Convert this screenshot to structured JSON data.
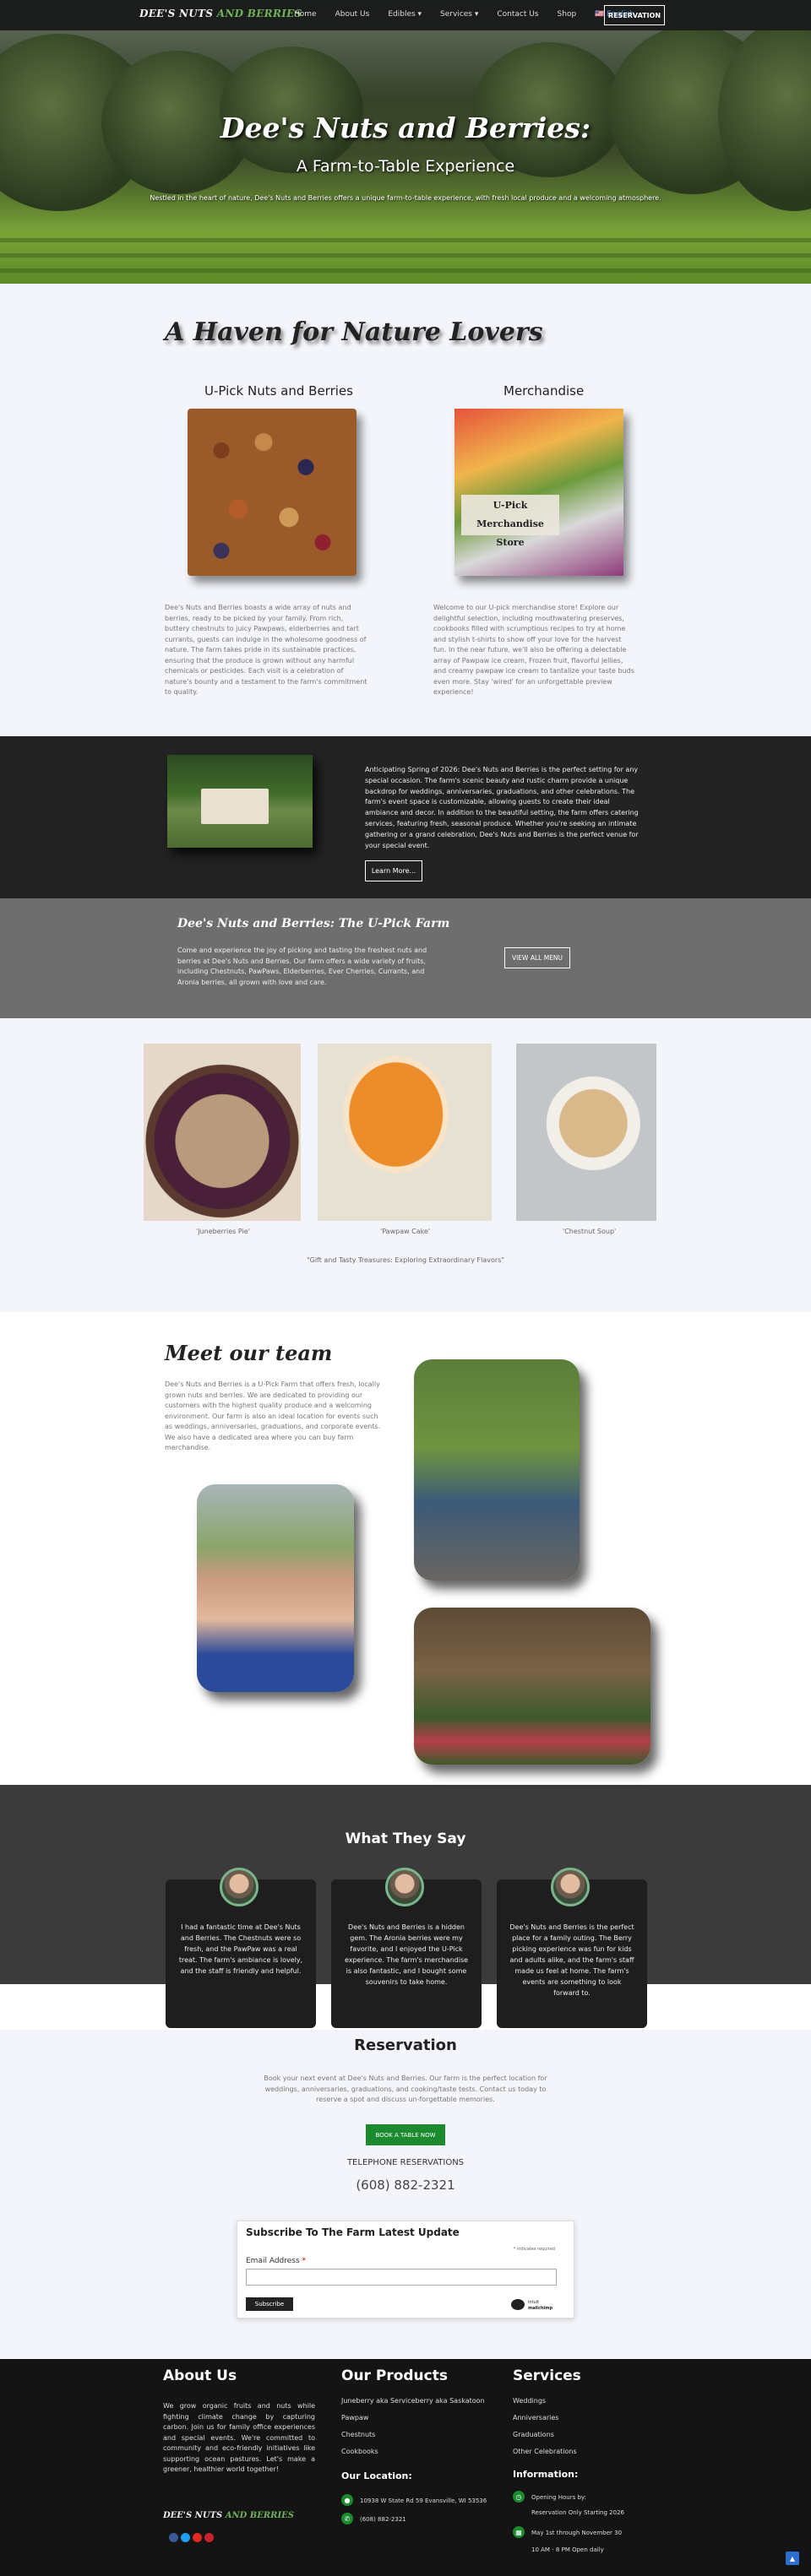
{
  "nav": {
    "logo_a": "DEE'S NUTS",
    "logo_b": " AND BERRIES",
    "links": [
      "Home",
      "About Us",
      "Edibles ▾",
      "Services ▾",
      "Contact Us",
      "Shop",
      "🇺🇸 English"
    ],
    "reservation": "RESERVATION"
  },
  "hero": {
    "title": "Dee's Nuts and Berries:",
    "subtitle": "A Farm-to-Table Experience",
    "text": "Nestled in the heart of nature, Dee's Nuts and Berries offers a unique farm-to-table experience, with fresh local produce and a welcoming atmosphere."
  },
  "haven": {
    "title": "A Haven for Nature Lovers",
    "left_heading": "U-Pick Nuts and Berries",
    "right_heading": "Merchandise",
    "merch_label_1": "U-Pick Merchandise",
    "merch_label_2": "Store",
    "left_text": "Dee's Nuts and Berries boasts a wide array of nuts and berries, ready to be picked by your family. From rich, buttery chestnuts to juicy Pawpaws, elderberries and tart currants, guests can indulge in the wholesome goodness of nature. The farm takes pride in its sustainable practices, ensuring that the produce is grown without any harmful chemicals or pesticides. Each visit is a celebration of nature's bounty and a testament to the farm's commitment to quality.",
    "right_text": "Welcome to our U-pick merchandise store! Explore our delightful selection, including mouthwatering preserves, cookbooks filled with scrumptious recipes to try at home and stylish t-shirts to show off your love for the harvest fun. In the near future, we'll also be offering a delectable array of Pawpaw ice cream, Frozen fruit, flavorful jellies, and creamy pawpaw ice cream to tantalize your taste buds even more. Stay 'wired' for an unforgettable preview experience!"
  },
  "events": {
    "text": "Anticipating Spring of 2026: Dee's Nuts and Berries is the perfect setting for any special occasion. The farm's scenic beauty and rustic charm provide a unique backdrop for weddings, anniversaries, graduations, and other celebrations. The farm's event space is customizable, allowing guests to create their ideal ambiance and decor. In addition to the beautiful setting, the farm offers catering services, featuring fresh, seasonal produce. Whether you're seeking an intimate gathering or a grand celebration, Dee's Nuts and Berries is the perfect venue for your special event.",
    "button": "Learn More..."
  },
  "upick": {
    "title": "Dee's Nuts and Berries: The U-Pick Farm",
    "text": "Come and experience the joy of picking and tasting the freshest nuts and berries at Dee's Nuts and Berries. Our farm offers a wide variety of fruits, including Chestnuts, PawPaws, Elderberries, Ever Cherries, Currants, and Aronia berries, all grown with love and care.",
    "button": "VIEW ALL MENU"
  },
  "foods": {
    "captions": [
      "'Juneberries Pie'",
      "'Pawpaw Cake'",
      "'Chestnut Soup'"
    ],
    "footer": "\"Gift and Tasty Treasures: Exploring Extraordinary Flavors\""
  },
  "team": {
    "title": "Meet our team",
    "text": "Dee's Nuts and Berries is a U-Pick Farm that offers fresh, locally grown nuts and berries. We are dedicated to providing our customers with the highest quality produce and a welcoming environment. Our farm is also an ideal location for events such as weddings, anniversaries, graduations, and corporate events. We also have a dedicated area where you can buy farm merchandise."
  },
  "testimonials": {
    "title": "What They Say",
    "items": [
      "I had a fantastic time at Dee's Nuts and Berries. The Chestnuts were so fresh, and the PawPaw was a real treat. The farm's ambiance is lovely, and the staff is friendly and helpful.",
      "Dee's Nuts and Berries is a hidden gem. The Aronia berries were my favorite, and I enjoyed the U-Pick experience. The farm's merchandise is also fantastic, and I bought some souvenirs to take home.",
      "Dee's Nuts and Berries is the perfect place for a family outing. The Berry picking experience was fun for kids and adults alike, and the farm's staff made us feel at home. The farm's events are something to look forward to."
    ]
  },
  "reservation": {
    "title": "Reservation",
    "text": "Book your next event at Dee's Nuts and Berries. Our farm is the perfect location for weddings, anniversaries, graduations, and cooking/taste tests. Contact us today to reserve a spot and discuss un-forgettable memories.",
    "button": "BOOK A TABLE NOW",
    "tel_label": "TELEPHONE RESERVATIONS",
    "phone": "(608) 882-2321"
  },
  "subscribe": {
    "title": "Subscribe To The Farm Latest Update",
    "indicates": "* indicates required",
    "email_label": "Email Address",
    "required": "*",
    "button": "Subscribe",
    "badge_1": "intuit",
    "badge_2": "mailchimp"
  },
  "footer": {
    "about_title": "About Us",
    "about_text": "We grow organic fruits and nuts while fighting climate change by capturing carbon. Join us for family office experiences and special events. We're committed to community and eco-friendly initiatives like supporting ocean pastures. Let's make a greener, healthier world together!",
    "logo_a": "DEE'S NUTS",
    "logo_b": " AND BERRIES",
    "products_title": "Our Products",
    "products": [
      "Juneberry aka Serviceberry aka Saskatoon",
      "Pawpaw",
      "Chestnuts",
      "Cookbooks"
    ],
    "services_title": "Services",
    "services": [
      "Weddings",
      "Anniversaries",
      "Graduations",
      "Other Celebrations"
    ],
    "location_title": "Our Location:",
    "address": "10938 W State Rd 59 Evansville, WI 53536",
    "phone": "(608) 882-2321",
    "info_title": "Information:",
    "hours_label": "Opening Hours by:",
    "hours_1": "Reservation Only Starting 2026",
    "hours_2": "May 1st through November 30",
    "hours_3": "10 AM - 8 PM Open daily",
    "to_top": "▲"
  }
}
